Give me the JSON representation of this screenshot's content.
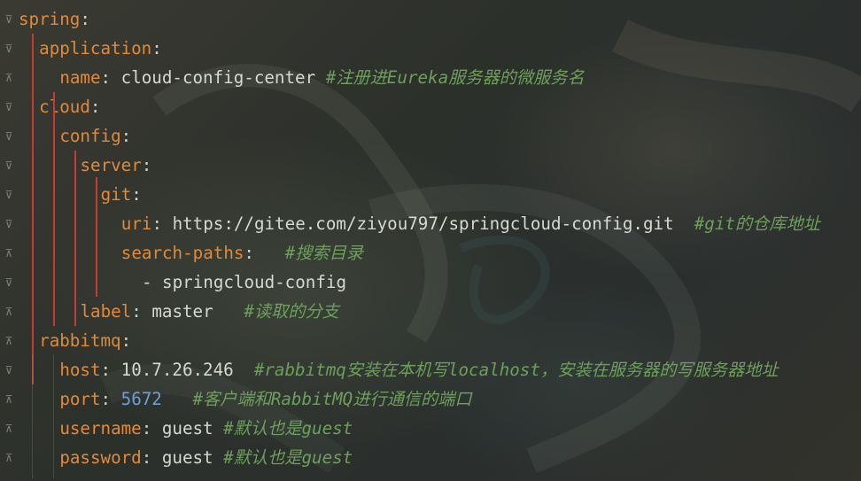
{
  "gutter": {
    "fold_icons": [
      "fold-open",
      "fold-open",
      "fold-close",
      "fold-open",
      "fold-open",
      "fold-open",
      "fold-open",
      "fold-open",
      "fold-close",
      "fold-open",
      "fold-close",
      "fold-close",
      "fold-open",
      "fold-close",
      "fold-close",
      "fold-close",
      "fold-close"
    ]
  },
  "colors": {
    "key": "#e08a3a",
    "value": "#d6d9cf",
    "number": "#6f9fd8",
    "comment": "#6ca05a",
    "indent_guide": "#c43d34"
  },
  "lines": [
    {
      "key": "spring",
      "sep": ":"
    },
    {
      "key": "application",
      "sep": ":"
    },
    {
      "key": "name",
      "sep": ":",
      "value": " cloud-config-center",
      "comment": " #注册进Eureka服务器的微服务名"
    },
    {
      "key": "cloud",
      "sep": ":"
    },
    {
      "key": "config",
      "sep": ":"
    },
    {
      "key": "server",
      "sep": ":"
    },
    {
      "key": "git",
      "sep": ":"
    },
    {
      "key": "uri",
      "sep": ":",
      "value": " https://gitee.com/ziyou797/springcloud-config.git",
      "comment": "  #git的仓库地址"
    },
    {
      "key": "search-paths",
      "sep": ":",
      "value": "   ",
      "comment": "#搜索目录"
    },
    {
      "value": "- springcloud-config"
    },
    {
      "key": "label",
      "sep": ":",
      "value": " master   ",
      "comment": "#读取的分支"
    },
    {
      "key": "rabbitmq",
      "sep": ":"
    },
    {
      "key": "host",
      "sep": ":",
      "value": " 10.7.26.246  ",
      "comment": "#rabbitmq安装在本机写localhost，安装在服务器的写服务器地址"
    },
    {
      "key": "port",
      "sep": ":",
      "number": " 5672",
      "comment": "   #客户端和RabbitMQ进行通信的端口"
    },
    {
      "key": "username",
      "sep": ":",
      "value": " guest ",
      "comment": "#默认也是guest"
    },
    {
      "key": "password",
      "sep": ":",
      "value": " guest ",
      "comment": "#默认也是guest"
    }
  ]
}
